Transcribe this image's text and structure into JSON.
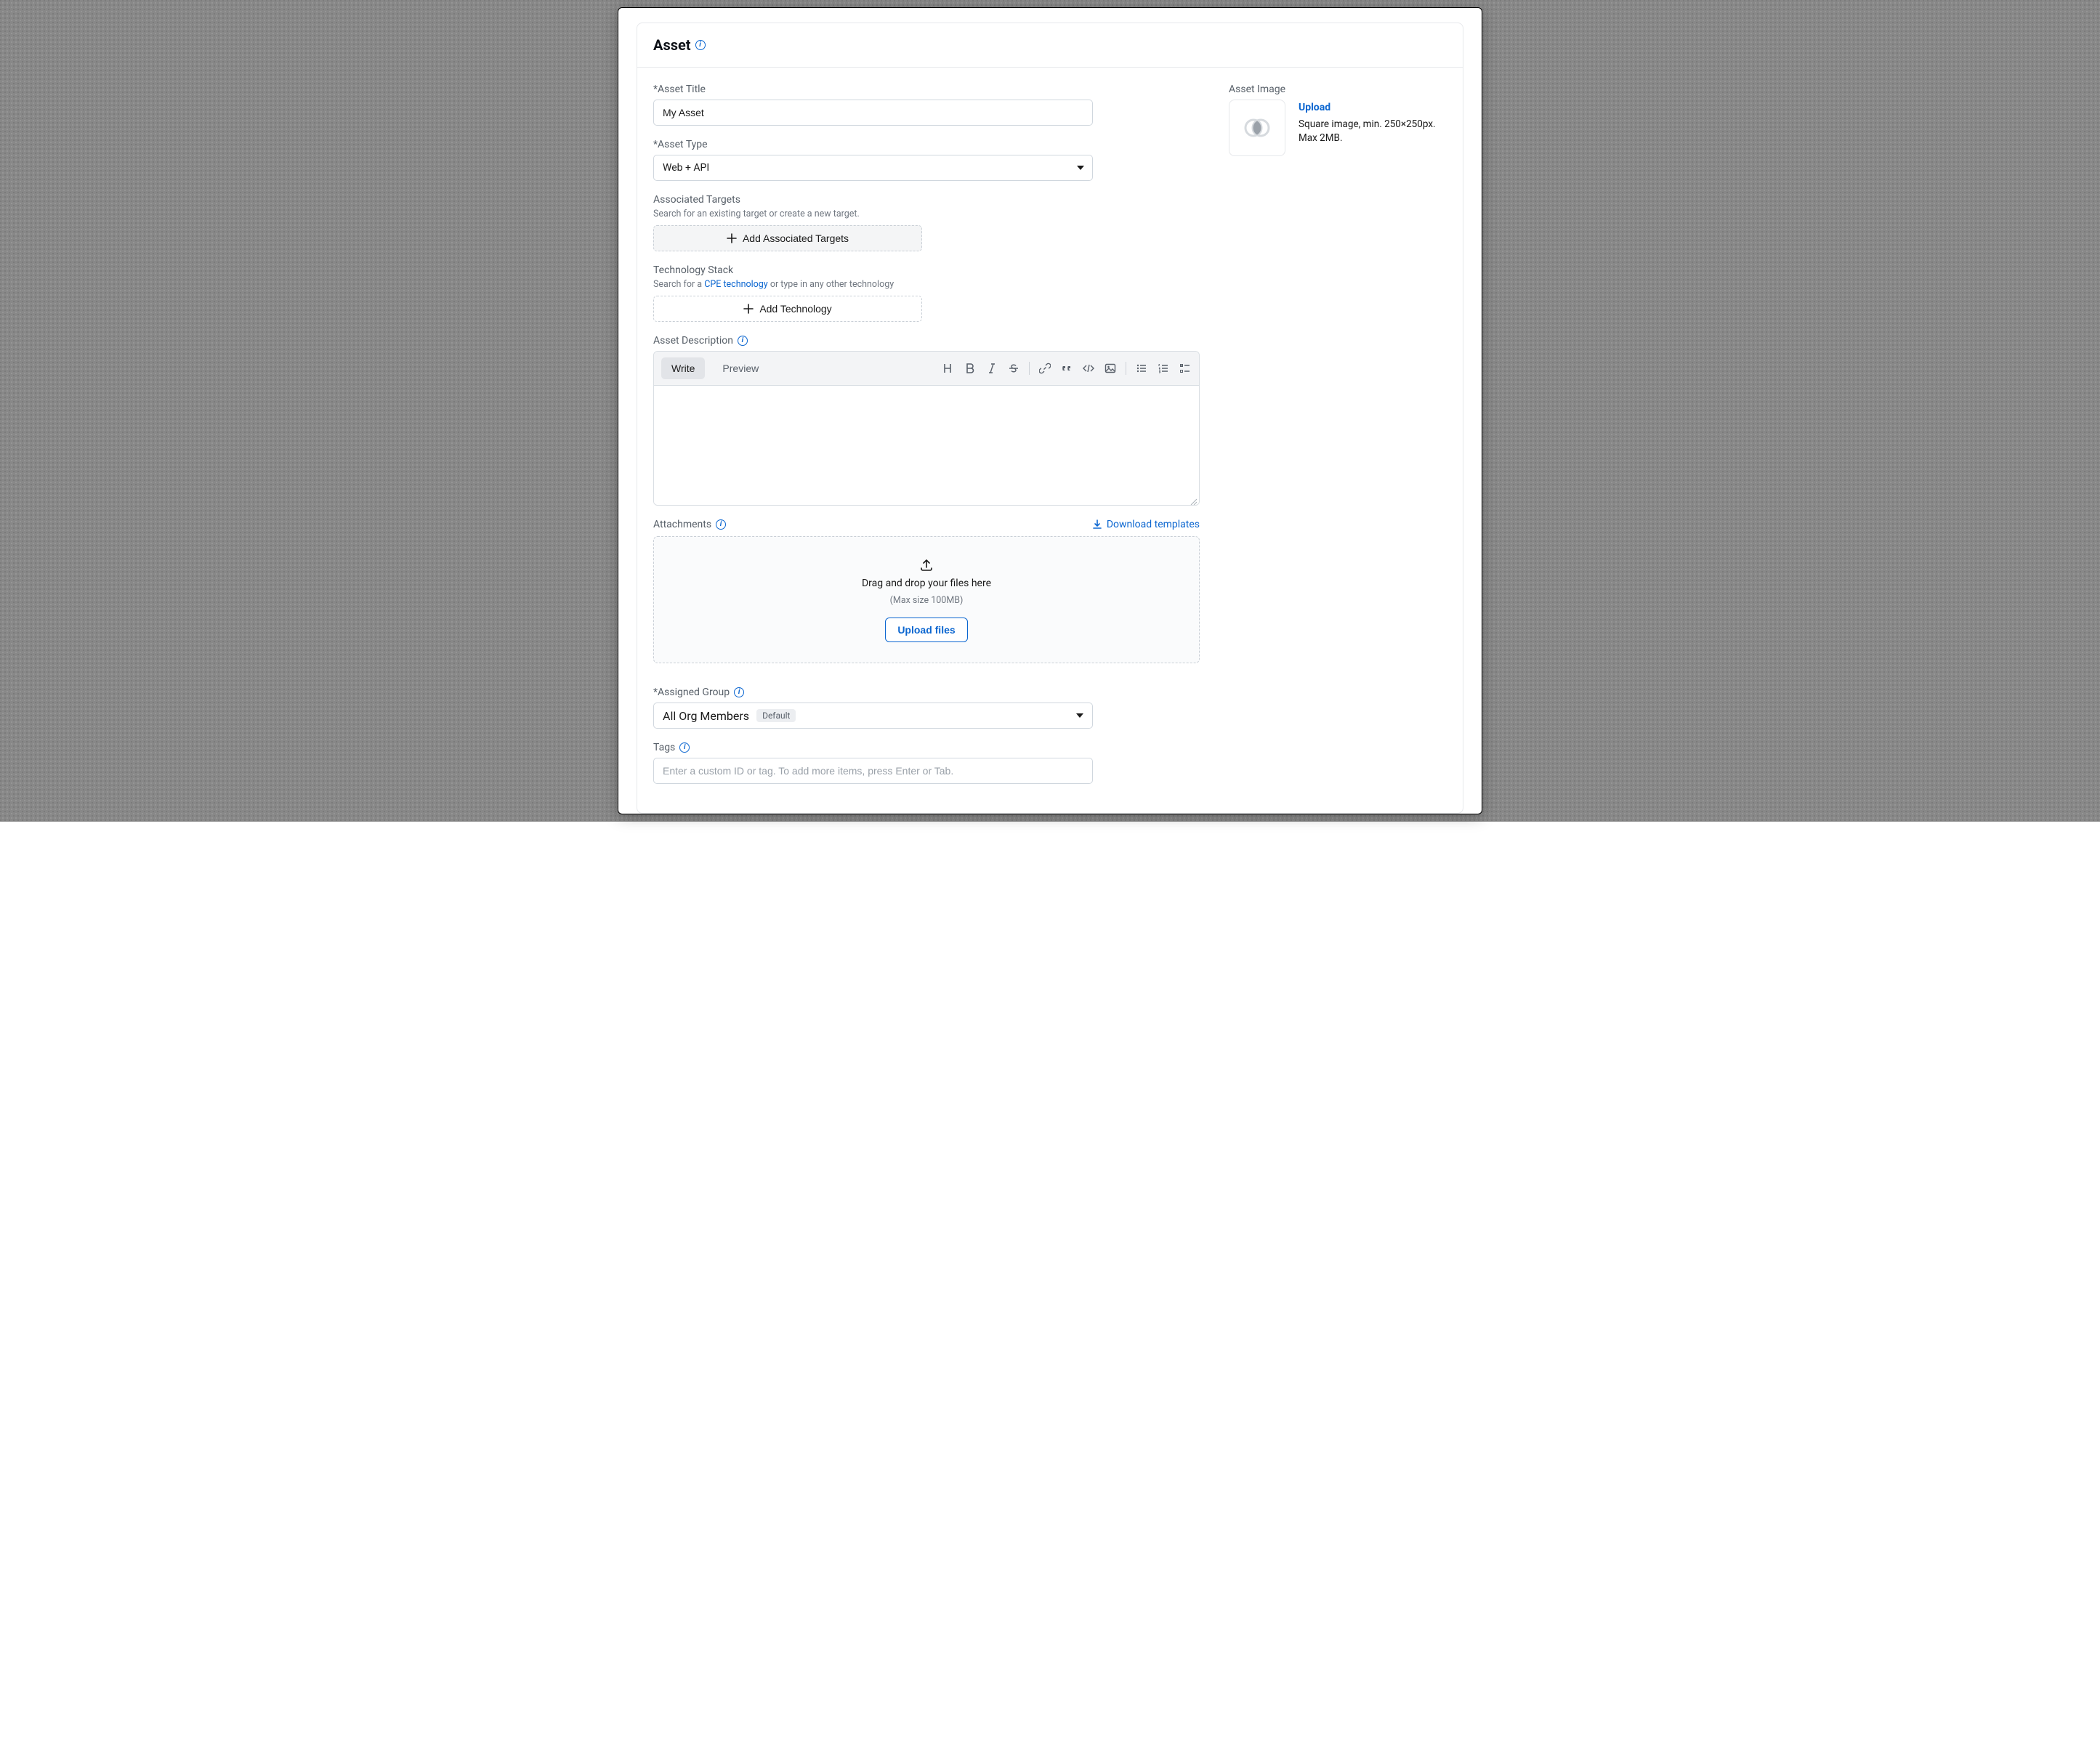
{
  "card": {
    "title": "Asset"
  },
  "form": {
    "title_label": "*Asset Title",
    "title_value": "My Asset",
    "type_label": "*Asset Type",
    "type_value": "Web + API",
    "targets_label": "Associated Targets",
    "targets_help": "Search for an existing target or create a new target.",
    "add_targets_btn": "Add Associated Targets",
    "tech_label": "Technology Stack",
    "tech_help_prefix": "Search for a ",
    "tech_help_link": "CPE technology",
    "tech_help_suffix": " or type in any other technology",
    "add_tech_btn": "Add Technology",
    "description_label": "Asset Description",
    "editor": {
      "tab_write": "Write",
      "tab_preview": "Preview"
    },
    "attachments_label": "Attachments",
    "download_templates": "Download templates",
    "dropzone_main": "Drag and drop your files here",
    "dropzone_sub": "(Max size 100MB)",
    "upload_files_btn": "Upload files",
    "assigned_group_label": "*Assigned Group",
    "assigned_group_value": "All Org Members",
    "assigned_group_badge": "Default",
    "tags_label": "Tags",
    "tags_placeholder": "Enter a custom ID or tag. To add more items, press Enter or Tab."
  },
  "aside": {
    "label": "Asset Image",
    "upload_link": "Upload",
    "help_line1": "Square image, min. 250×250px.",
    "help_line2": "Max 2MB."
  }
}
